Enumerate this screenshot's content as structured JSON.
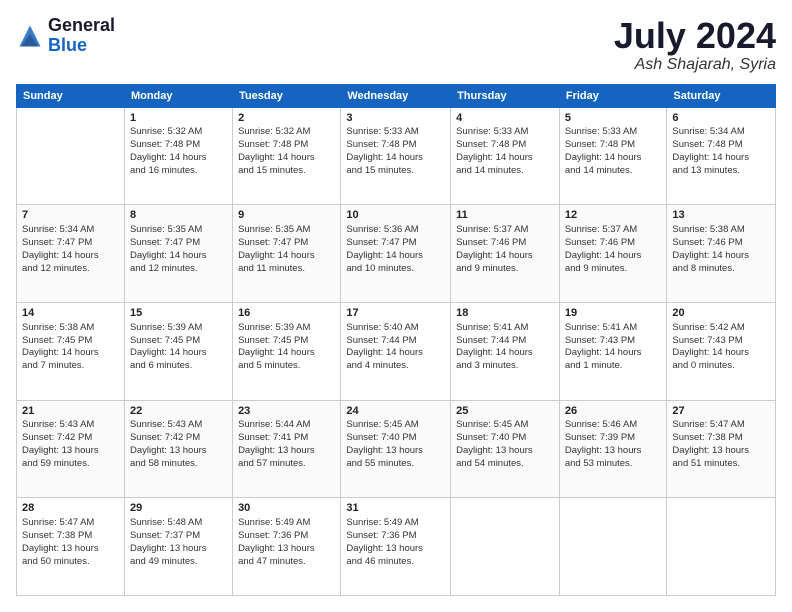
{
  "header": {
    "logo_line1": "General",
    "logo_line2": "Blue",
    "month_year": "July 2024",
    "location": "Ash Shajarah, Syria"
  },
  "days_of_week": [
    "Sunday",
    "Monday",
    "Tuesday",
    "Wednesday",
    "Thursday",
    "Friday",
    "Saturday"
  ],
  "weeks": [
    [
      {
        "day": "",
        "info": ""
      },
      {
        "day": "1",
        "info": "Sunrise: 5:32 AM\nSunset: 7:48 PM\nDaylight: 14 hours\nand 16 minutes."
      },
      {
        "day": "2",
        "info": "Sunrise: 5:32 AM\nSunset: 7:48 PM\nDaylight: 14 hours\nand 15 minutes."
      },
      {
        "day": "3",
        "info": "Sunrise: 5:33 AM\nSunset: 7:48 PM\nDaylight: 14 hours\nand 15 minutes."
      },
      {
        "day": "4",
        "info": "Sunrise: 5:33 AM\nSunset: 7:48 PM\nDaylight: 14 hours\nand 14 minutes."
      },
      {
        "day": "5",
        "info": "Sunrise: 5:33 AM\nSunset: 7:48 PM\nDaylight: 14 hours\nand 14 minutes."
      },
      {
        "day": "6",
        "info": "Sunrise: 5:34 AM\nSunset: 7:48 PM\nDaylight: 14 hours\nand 13 minutes."
      }
    ],
    [
      {
        "day": "7",
        "info": "Sunrise: 5:34 AM\nSunset: 7:47 PM\nDaylight: 14 hours\nand 12 minutes."
      },
      {
        "day": "8",
        "info": "Sunrise: 5:35 AM\nSunset: 7:47 PM\nDaylight: 14 hours\nand 12 minutes."
      },
      {
        "day": "9",
        "info": "Sunrise: 5:35 AM\nSunset: 7:47 PM\nDaylight: 14 hours\nand 11 minutes."
      },
      {
        "day": "10",
        "info": "Sunrise: 5:36 AM\nSunset: 7:47 PM\nDaylight: 14 hours\nand 10 minutes."
      },
      {
        "day": "11",
        "info": "Sunrise: 5:37 AM\nSunset: 7:46 PM\nDaylight: 14 hours\nand 9 minutes."
      },
      {
        "day": "12",
        "info": "Sunrise: 5:37 AM\nSunset: 7:46 PM\nDaylight: 14 hours\nand 9 minutes."
      },
      {
        "day": "13",
        "info": "Sunrise: 5:38 AM\nSunset: 7:46 PM\nDaylight: 14 hours\nand 8 minutes."
      }
    ],
    [
      {
        "day": "14",
        "info": "Sunrise: 5:38 AM\nSunset: 7:45 PM\nDaylight: 14 hours\nand 7 minutes."
      },
      {
        "day": "15",
        "info": "Sunrise: 5:39 AM\nSunset: 7:45 PM\nDaylight: 14 hours\nand 6 minutes."
      },
      {
        "day": "16",
        "info": "Sunrise: 5:39 AM\nSunset: 7:45 PM\nDaylight: 14 hours\nand 5 minutes."
      },
      {
        "day": "17",
        "info": "Sunrise: 5:40 AM\nSunset: 7:44 PM\nDaylight: 14 hours\nand 4 minutes."
      },
      {
        "day": "18",
        "info": "Sunrise: 5:41 AM\nSunset: 7:44 PM\nDaylight: 14 hours\nand 3 minutes."
      },
      {
        "day": "19",
        "info": "Sunrise: 5:41 AM\nSunset: 7:43 PM\nDaylight: 14 hours\nand 1 minute."
      },
      {
        "day": "20",
        "info": "Sunrise: 5:42 AM\nSunset: 7:43 PM\nDaylight: 14 hours\nand 0 minutes."
      }
    ],
    [
      {
        "day": "21",
        "info": "Sunrise: 5:43 AM\nSunset: 7:42 PM\nDaylight: 13 hours\nand 59 minutes."
      },
      {
        "day": "22",
        "info": "Sunrise: 5:43 AM\nSunset: 7:42 PM\nDaylight: 13 hours\nand 58 minutes."
      },
      {
        "day": "23",
        "info": "Sunrise: 5:44 AM\nSunset: 7:41 PM\nDaylight: 13 hours\nand 57 minutes."
      },
      {
        "day": "24",
        "info": "Sunrise: 5:45 AM\nSunset: 7:40 PM\nDaylight: 13 hours\nand 55 minutes."
      },
      {
        "day": "25",
        "info": "Sunrise: 5:45 AM\nSunset: 7:40 PM\nDaylight: 13 hours\nand 54 minutes."
      },
      {
        "day": "26",
        "info": "Sunrise: 5:46 AM\nSunset: 7:39 PM\nDaylight: 13 hours\nand 53 minutes."
      },
      {
        "day": "27",
        "info": "Sunrise: 5:47 AM\nSunset: 7:38 PM\nDaylight: 13 hours\nand 51 minutes."
      }
    ],
    [
      {
        "day": "28",
        "info": "Sunrise: 5:47 AM\nSunset: 7:38 PM\nDaylight: 13 hours\nand 50 minutes."
      },
      {
        "day": "29",
        "info": "Sunrise: 5:48 AM\nSunset: 7:37 PM\nDaylight: 13 hours\nand 49 minutes."
      },
      {
        "day": "30",
        "info": "Sunrise: 5:49 AM\nSunset: 7:36 PM\nDaylight: 13 hours\nand 47 minutes."
      },
      {
        "day": "31",
        "info": "Sunrise: 5:49 AM\nSunset: 7:36 PM\nDaylight: 13 hours\nand 46 minutes."
      },
      {
        "day": "",
        "info": ""
      },
      {
        "day": "",
        "info": ""
      },
      {
        "day": "",
        "info": ""
      }
    ]
  ]
}
